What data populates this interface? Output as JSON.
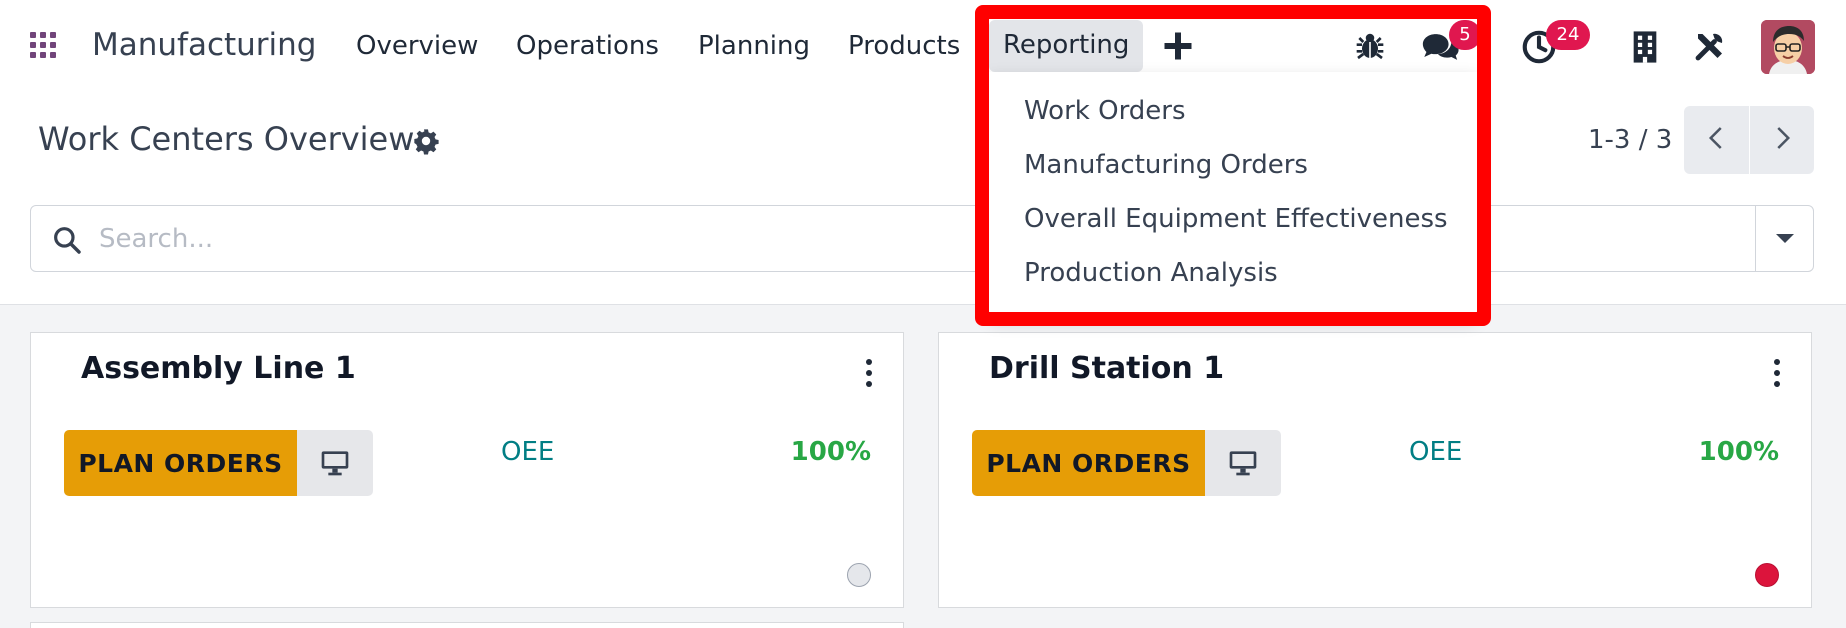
{
  "navbar": {
    "app_name": "Manufacturing",
    "menu": [
      {
        "label": "Overview"
      },
      {
        "label": "Operations"
      },
      {
        "label": "Planning"
      },
      {
        "label": "Products"
      },
      {
        "label": "Reporting"
      }
    ],
    "systray": {
      "messages_count": "5",
      "activities_count": "24"
    }
  },
  "reporting_dropdown": {
    "items": [
      {
        "label": "Work Orders"
      },
      {
        "label": "Manufacturing Orders"
      },
      {
        "label": "Overall Equipment Effectiveness"
      },
      {
        "label": "Production Analysis"
      }
    ]
  },
  "control_panel": {
    "title": "Work Centers Overview",
    "pager": "1-3 / 3",
    "search_placeholder": "Search..."
  },
  "cards": [
    {
      "title": "Assembly Line 1",
      "button_label": "PLAN ORDERS",
      "oee_label": "OEE",
      "oee_value": "100%",
      "status_color": "grey"
    },
    {
      "title": "Drill Station 1",
      "button_label": "PLAN ORDERS",
      "oee_label": "OEE",
      "oee_value": "100%",
      "status_color": "red"
    }
  ],
  "colors": {
    "brand": "#71457a",
    "plan_button": "#e69d06",
    "oee_label": "#017e84",
    "oee_value": "#28a745",
    "badge": "#e0174f",
    "highlight": "#ff0000"
  }
}
